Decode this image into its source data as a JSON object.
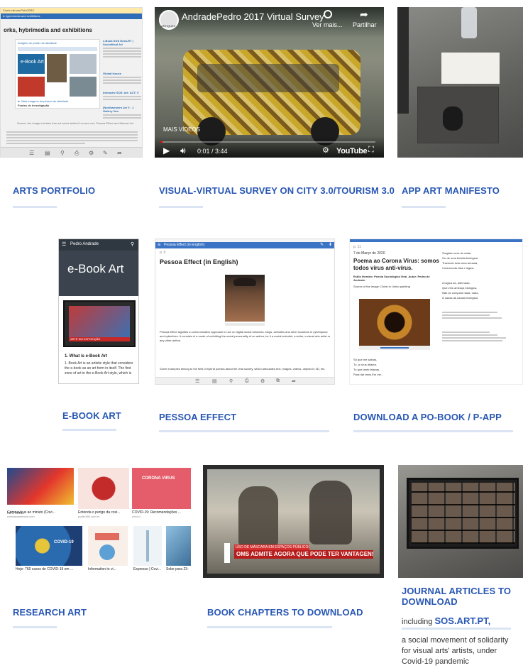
{
  "tiles": {
    "portfolio": {
      "title": "ARTS PORTFOLIO",
      "doc_banner": "Come visi ww.PoloCEBC",
      "doc_subbar": "& hypermedia and exhibitions",
      "doc_heading": "orks, hybrimedia and exhibitions",
      "doc_item1": "Imagem de poster de atividade",
      "doc_item2": "e-Book Art",
      "doc_link": "► Mais imagens da pintura de atividade",
      "doc_link2": "Fontes de Investigação",
      "doc_side1": "e-Book SOS Desk-RT | Sociolitical Art",
      "doc_side2": "Global Issues",
      "doc_side3": "Interactiv SOS: Art: ACT: V",
      "doc_side4": "(Northwestern Art V - 1 Gallery Voo",
      "doc_caption": "Source: the image includes free art works behind Lorenzo net, Pessoa Effect and Manuel-Art"
    },
    "video": {
      "title": "VISUAL-VIRTUAL SURVEY ON CITY 3.0/TOURISM 3.0",
      "video_title": "AndradePedro 2017 Virtual Survey",
      "channel_badge": "ARTIQUES",
      "watch_later": "Ver mais...",
      "share": "Partilhar",
      "more_videos": "MAIS VÍDEOS",
      "time": "0:01 / 3:44",
      "platform": "YouTube"
    },
    "manifesto": {
      "title": "APP ART MANIFESTO"
    },
    "ebook": {
      "title": "E-BOOK ART",
      "author": "Pedro Andrade",
      "cover_title": "e-Book Art",
      "section": "1. What is e-Book Art",
      "text": "1. Book Art is an artistic style that considers the e-book as an art form in itself. The first zone of art in the e-Book Art style, which is",
      "tv_caption": "ARTE EM EXPOSIÇÃO"
    },
    "pessoa": {
      "title": "PESSOA EFFECT",
      "window_title": "Pessoa Effect (in English)",
      "crumb": "p. 9",
      "heading": "Pessoa Effect (in English)",
      "body": "Pessoa Effect signifies a communicative approach in use on digital social networks, blogs, websites and other locations in cyberspace and cyberlives. It consists of a mode of unfolding the social personality of an author, be it a social scientist, a writer, a visual arts artist or any other author.",
      "body2": "Some examples belong to the field of hybrid poetics about the viral society, which articulates text, images, videos, objects in 3D, etc."
    },
    "pobook": {
      "title": "DOWNLOAD A PO-BOOK / P-APP",
      "crumb": "p. 11",
      "date": "7 de Março de 2020",
      "heading": "Poema ao Corona Vírus: somos todos vírus anti-vírus.",
      "meta": "Estilo literário: Poesia Sociológica Viral. Autor: Pedro de Andrade.",
      "source": "Source of the image: Christ in Limbo painting",
      "col_line1": "Surgiste nova do nada,",
      "col_line2": "Ou de uma bebida biológica,",
      "col_line3": "Trazendo toda uma armada,",
      "col_line4": "Contra toda vida e lógica.",
      "col_line5": "A lógica da, alternada,",
      "col_line6": "Que veio ameaça biólogica,",
      "col_line7": "Não se compara nada, nada,",
      "col_line8": "À causa da causa ecológica.",
      "bottom1": "Só que me sabías,",
      "bottom2": "Tu, a vírus ditador,",
      "bottom3": "Tu que tanto falavas,",
      "bottom4": "Para dár bens.Em me..."
    },
    "research": {
      "title": "RESEARCH ART",
      "cards": [
        {
          "label": "Coronavírus ao minuto (Covi...",
          "src": "noticiasaominuto.com",
          "time": "há 5 horas"
        },
        {
          "label": "Entenda o perigo da covi...",
          "src": "poder360.com.br"
        },
        {
          "label": "COVID-19: Recomendações ...",
          "src": "omd.ci"
        },
        {
          "label": "Hoje: 760 casos de COVID-19 em ...",
          "src": "verdadeiroolhar.pt"
        },
        {
          "label": "Information to vi...",
          "src": "visitmadeira.pt"
        },
        {
          "label": "Expresso | Covi...",
          "src": "expresso.pt"
        },
        {
          "label": "Sobe para 23-",
          "src": "jornalnordeste"
        }
      ],
      "virus_text": "CORONA VIRUS",
      "covid_text": "COVID-19"
    },
    "chapters": {
      "title": "BOOK CHAPTERS TO DOWNLOAD",
      "ticker_top": "USO DE MÁSCARA EM ESPAÇOS PÚBLICOS",
      "ticker_main": "OMS ADMITE AGORA QUE PODE TER VANTAGENS"
    },
    "journal": {
      "title": "JOURNAL ARTICLES TO DOWNLOAD",
      "including": "including",
      "brand": "SOS.ART.PT,",
      "desc": "a social movement of solidarity for visual arts' artists, under Covid-19 pandemic"
    }
  },
  "colors": {
    "title_blue": "#2857b4",
    "underline": "#dbe4f3",
    "youtube_red": "#ff0000"
  }
}
